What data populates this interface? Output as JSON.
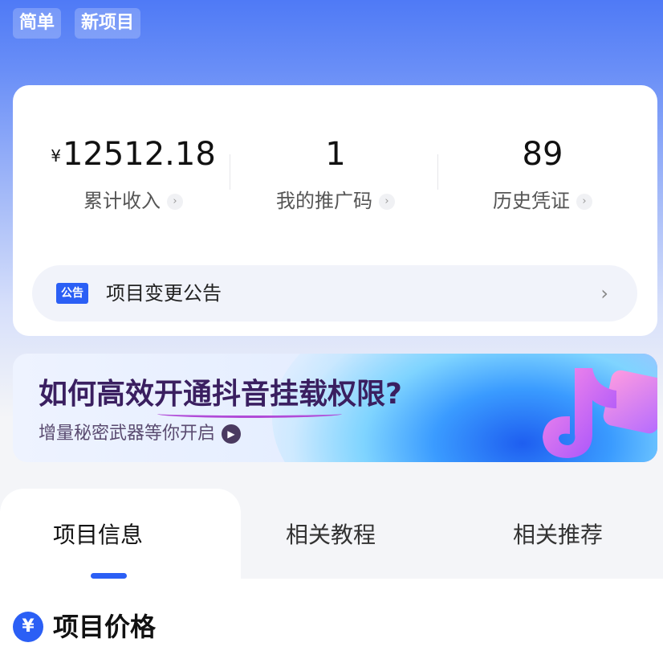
{
  "header": {
    "tags": [
      "简单",
      "新项目"
    ]
  },
  "stats": {
    "income": {
      "currency": "¥",
      "value": "12512.18",
      "label": "累计收入"
    },
    "promo_code": {
      "value": "1",
      "label": "我的推广码"
    },
    "vouchers": {
      "value": "89",
      "label": "历史凭证"
    }
  },
  "notice": {
    "badge": "公告",
    "text": "项目变更公告",
    "chevron": "›"
  },
  "banner": {
    "title": "如何高效开通抖音挂载权限?",
    "subtitle": "增量秘密武器等你开启"
  },
  "tabs": [
    {
      "label": "项目信息",
      "active": true
    },
    {
      "label": "相关教程",
      "active": false
    },
    {
      "label": "相关推荐",
      "active": false
    }
  ],
  "section": {
    "icon_glyph": "¥",
    "title": "项目价格"
  },
  "colors": {
    "accent": "#2b5ff5",
    "header_blue": "#4f7af6"
  }
}
